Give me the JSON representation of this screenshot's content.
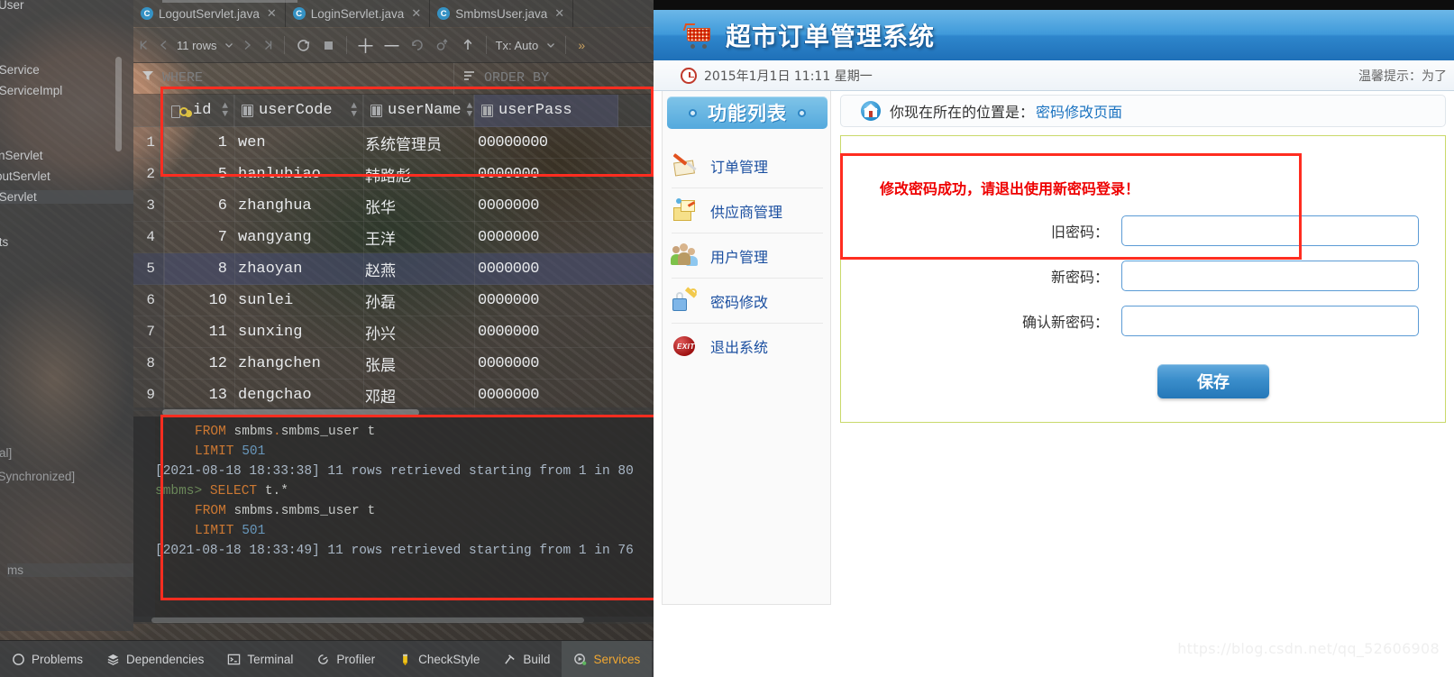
{
  "ide": {
    "tabs": [
      {
        "label": "LogoutServlet.java",
        "icon": "class-icon"
      },
      {
        "label": "LoginServlet.java",
        "icon": "class-icon"
      },
      {
        "label": "SmbmsUser.java",
        "icon": "class-icon"
      }
    ],
    "tree_items": [
      {
        "label": "msUser"
      },
      {
        "label": "serService"
      },
      {
        "label": "serServiceImpl"
      },
      {
        "label": "oginServlet"
      },
      {
        "label": "ogoutServlet"
      },
      {
        "label": "serServlet"
      },
      {
        "label": "tants"
      }
    ],
    "db_tree": [
      {
        "label": "[local]",
        "prefix": ""
      },
      {
        "label": "[Synchronized]",
        "prefix": "ar"
      },
      {
        "label": "s",
        "prefix": ""
      },
      {
        "label": "ms",
        "prefix": ""
      }
    ],
    "toolbar": {
      "rows_label": "11 rows",
      "tx_label": "Tx: Auto",
      "first_icon": "first-page-icon",
      "prev_icon": "prev-page-icon",
      "next_icon": "next-page-icon",
      "last_icon": "last-page-icon",
      "refresh_icon": "refresh-icon",
      "stop_icon": "stop-icon",
      "add_icon": "add-row-icon",
      "remove_icon": "remove-row-icon",
      "revert_icon": "revert-icon",
      "commit_icon": "commit-icon",
      "submit_icon": "submit-icon",
      "overflow_icon": "chevron-right-icon"
    },
    "filter": {
      "where_label": "WHERE",
      "orderby_label": "ORDER BY",
      "filter_icon": "filter-icon",
      "sort_icon": "sort-icon"
    },
    "grid": {
      "columns": [
        {
          "name": "id",
          "icon": "primary-key-icon"
        },
        {
          "name": "userCode",
          "icon": "column-icon"
        },
        {
          "name": "userName",
          "icon": "column-icon"
        },
        {
          "name": "userPass",
          "icon": "column-icon"
        }
      ],
      "rows": [
        {
          "n": "1",
          "id": "1",
          "userCode": "wen",
          "userName": "系统管理员",
          "userPass": "00000000",
          "selected": false
        },
        {
          "n": "2",
          "id": "5",
          "userCode": "hanlubiao",
          "userName": "韩路彪",
          "userPass": "0000000",
          "selected": false
        },
        {
          "n": "3",
          "id": "6",
          "userCode": "zhanghua",
          "userName": "张华",
          "userPass": "0000000",
          "selected": false
        },
        {
          "n": "4",
          "id": "7",
          "userCode": "wangyang",
          "userName": "王洋",
          "userPass": "0000000",
          "selected": false
        },
        {
          "n": "5",
          "id": "8",
          "userCode": "zhaoyan",
          "userName": "赵燕",
          "userPass": "0000000",
          "selected": true
        },
        {
          "n": "6",
          "id": "10",
          "userCode": "sunlei",
          "userName": "孙磊",
          "userPass": "0000000",
          "selected": false
        },
        {
          "n": "7",
          "id": "11",
          "userCode": "sunxing",
          "userName": "孙兴",
          "userPass": "0000000",
          "selected": false
        },
        {
          "n": "8",
          "id": "12",
          "userCode": "zhangchen",
          "userName": "张晨",
          "userPass": "0000000",
          "selected": false
        },
        {
          "n": "9",
          "id": "13",
          "userCode": "dengchao",
          "userName": "邓超",
          "userPass": "0000000",
          "selected": false
        }
      ]
    },
    "console": {
      "l1_kw": "FROM",
      "l1_a": "smbms",
      "l1_dot": ".",
      "l1_b": "smbms_user t",
      "l2_kw": "LIMIT",
      "l2_num": "501",
      "l3": "[2021-08-18 18:33:38] 11 rows retrieved starting from 1 in 80",
      "l4_prompt": "smbms>",
      "l4_kw": "SELECT",
      "l4_rest": "t.*",
      "l5_kw": "FROM",
      "l5_rest": "smbms.smbms_user t",
      "l6_kw": "LIMIT",
      "l6_num": "501",
      "l7": "[2021-08-18 18:33:49] 11 rows retrieved starting from 1 in 76"
    },
    "statusbar": [
      {
        "label": "Problems",
        "icon": "problems-icon",
        "active": false
      },
      {
        "label": "Dependencies",
        "icon": "dependencies-icon",
        "active": false
      },
      {
        "label": "Terminal",
        "icon": "terminal-icon",
        "active": false
      },
      {
        "label": "Profiler",
        "icon": "profiler-icon",
        "active": false
      },
      {
        "label": "CheckStyle",
        "icon": "checkstyle-icon",
        "active": false
      },
      {
        "label": "Build",
        "icon": "build-icon",
        "active": false
      },
      {
        "label": "Services",
        "icon": "services-icon",
        "active": true
      }
    ]
  },
  "web": {
    "header": {
      "title": "超市订单管理系统",
      "cart_icon": "shopping-cart-icon"
    },
    "infobar": {
      "clock_icon": "clock-icon",
      "datetime": "2015年1月1日 11:11 星期一",
      "tip": "温馨提示：为了"
    },
    "sidebar": {
      "title": "功能列表",
      "items": [
        {
          "label": "订单管理",
          "icon": "order-icon"
        },
        {
          "label": "供应商管理",
          "icon": "supplier-icon"
        },
        {
          "label": "用户管理",
          "icon": "users-icon"
        },
        {
          "label": "密码修改",
          "icon": "lock-key-icon"
        },
        {
          "label": "退出系统",
          "icon": "exit-icon"
        }
      ]
    },
    "breadcrumb": {
      "home_icon": "home-icon",
      "prefix": "你现在所在的位置是：",
      "location": "密码修改页面"
    },
    "form": {
      "message": "修改密码成功，请退出使用新密码登录！",
      "fields": [
        {
          "label": "旧密码：",
          "value": "",
          "placeholder": ""
        },
        {
          "label": "新密码：",
          "value": "",
          "placeholder": ""
        },
        {
          "label": "确认新密码：",
          "value": "",
          "placeholder": ""
        }
      ],
      "save_label": "保存"
    },
    "watermark": "https://blog.csdn.net/qq_52606908"
  },
  "colors": {
    "web_accent": "#1b4fa0",
    "header_blue": "#3f9ada",
    "error_red": "#ee0000",
    "annotation_red": "#ff2d20",
    "ide_bg": "#3c3f41"
  }
}
